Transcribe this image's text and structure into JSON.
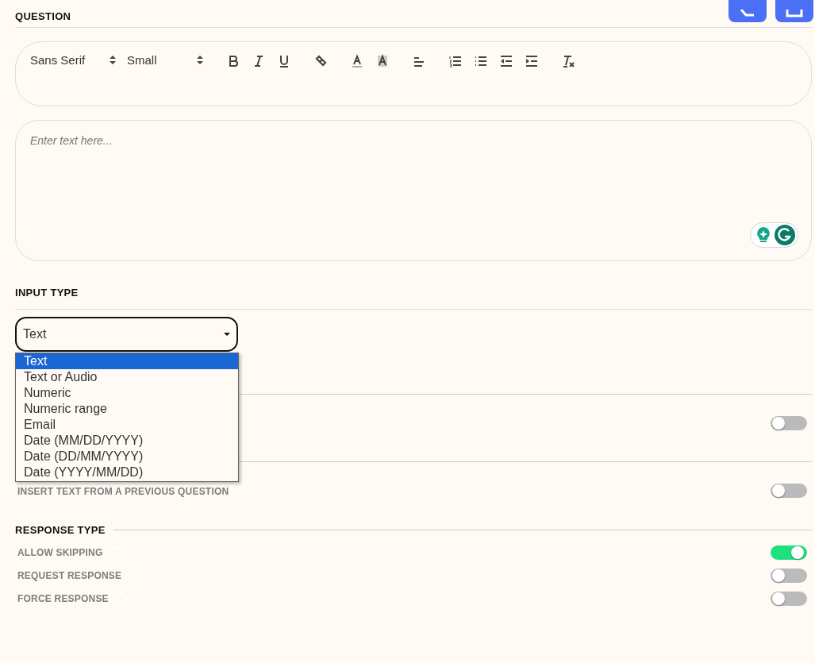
{
  "question": {
    "heading": "QUESTION",
    "editor": {
      "font": "Sans Serif",
      "size": "Small",
      "placeholder": "Enter text here..."
    }
  },
  "input_type": {
    "heading": "INPUT TYPE",
    "value": "Text",
    "expanded": true,
    "options": [
      {
        "label": "Text",
        "selected": true
      },
      {
        "label": "Text or Audio",
        "selected": false
      },
      {
        "label": "Numeric",
        "selected": false
      },
      {
        "label": "Numeric range",
        "selected": false
      },
      {
        "label": "Email",
        "selected": false
      },
      {
        "label": "Date (MM/DD/YYYY)",
        "selected": false
      },
      {
        "label": "Date (DD/MM/YYYY)",
        "selected": false
      },
      {
        "label": "Date (YYYY/MM/DD)",
        "selected": false
      }
    ]
  },
  "settings": [
    {
      "on": false
    },
    {
      "label": "INSERT TEXT FROM A PREVIOUS QUESTION",
      "on": false
    }
  ],
  "response_type": {
    "heading": "RESPONSE TYPE",
    "items": [
      {
        "label": "ALLOW SKIPPING",
        "on": true
      },
      {
        "label": "REQUEST RESPONSE",
        "on": false
      },
      {
        "label": "FORCE RESPONSE",
        "on": false
      }
    ]
  }
}
